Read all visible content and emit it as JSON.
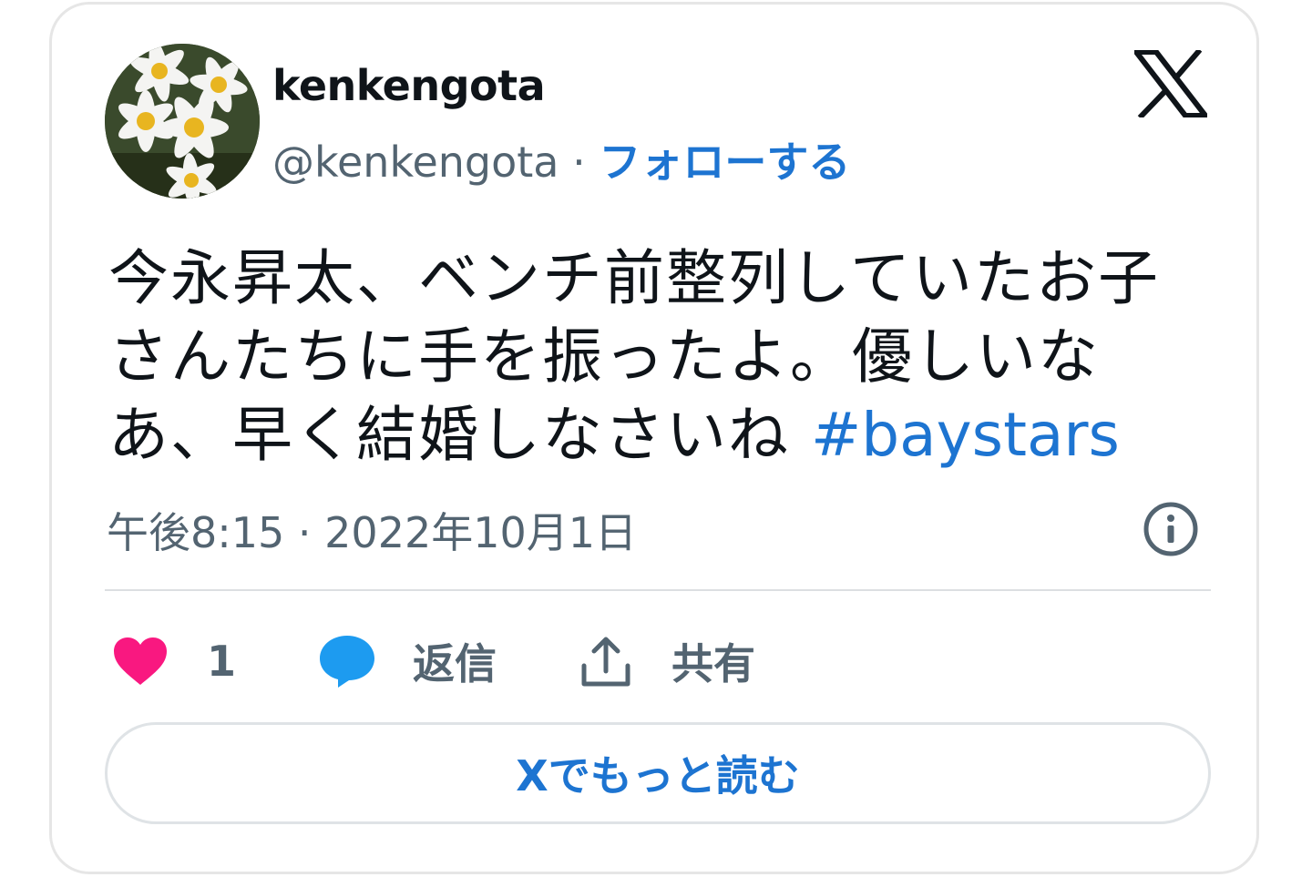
{
  "author": {
    "display_name": "kenkengota",
    "handle": "@kenkengota",
    "separator": " · ",
    "follow_label": "フォローする"
  },
  "tweet": {
    "text": "今永昇太、ベンチ前整列していたお子さんたちに手を振ったよ。優しいなあ、早く結婚しなさいね ",
    "hashtag": "#baystars",
    "timestamp": "午後8:15 · 2022年10月1日"
  },
  "actions": {
    "like_count": "1",
    "reply_label": "返信",
    "share_label": "共有"
  },
  "read_more_label": "Xでもっと読む",
  "colors": {
    "accent": "#1d74d1",
    "heart": "#f91880",
    "reply_bubble": "#1d9bf0",
    "muted_text": "#536471"
  },
  "icons": [
    "x-logo-icon",
    "info-icon",
    "heart-icon",
    "reply-bubble-icon",
    "share-icon"
  ]
}
